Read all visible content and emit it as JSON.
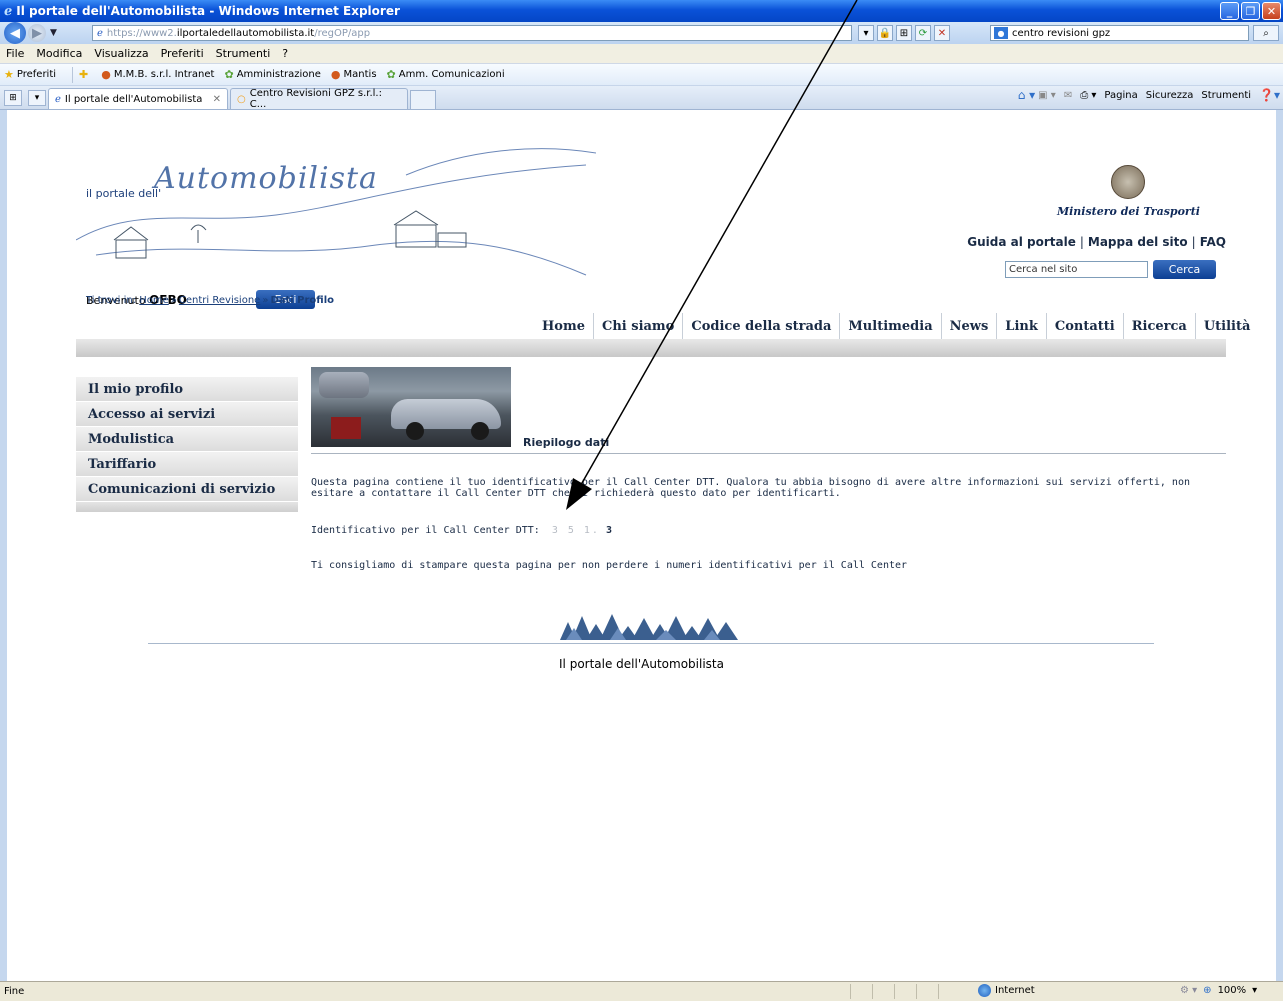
{
  "window": {
    "title": "Il portale dell'Automobilista - Windows Internet Explorer"
  },
  "address_bar": {
    "url_prefix": "https://www2.",
    "url_host": "ilportaledellautomobilista.it",
    "url_path": "/regOP/app",
    "search_value": "centro revisioni gpz"
  },
  "menu": [
    "File",
    "Modifica",
    "Visualizza",
    "Preferiti",
    "Strumenti",
    "?"
  ],
  "favorites": {
    "label": "Preferiti",
    "items": [
      "M.M.B. s.r.l. Intranet",
      "Amministrazione",
      "Mantis",
      "Amm. Comunicazioni"
    ]
  },
  "tabs": [
    {
      "label": "Il portale dell'Automobilista",
      "active": true
    },
    {
      "label": "Centro Revisioni GPZ s.r.l.: C...",
      "active": false
    }
  ],
  "command_bar": [
    "Pagina",
    "Sicurezza",
    "Strumenti"
  ],
  "page": {
    "logo_small": "il portale dell'",
    "logo_big": "Automobilista",
    "welcome_prefix": "Benvenuto",
    "user": "OFBO",
    "logout": "Esci",
    "ministry": "Ministero dei Trasporti",
    "toplinks": [
      "Guida al portale",
      "Mappa del sito",
      "FAQ"
    ],
    "search_placeholder": "Cerca nel sito",
    "search_button": "Cerca",
    "breadcrumb": {
      "prefix": "Ti trovi in:",
      "home": "Home",
      "section": "Centri Revisione",
      "current": "Dati Profilo"
    },
    "nav": [
      "Home",
      "Chi siamo",
      "Codice della strada",
      "Multimedia",
      "News",
      "Link",
      "Contatti",
      "Ricerca",
      "Utilità"
    ],
    "sidebar": [
      "Il mio profilo",
      "Accesso ai servizi",
      "Modulistica",
      "Tariffario",
      "Comunicazioni di servizio"
    ],
    "section_title": "Riepilogo dati",
    "paragraph1": "Questa pagina contiene il tuo identificativo per il Call Center DTT. Qualora tu abbia bisogno di avere altre informazioni sui servizi offerti, non esitare a contattare il Call Center DTT che ti richiederà questo dato per identificarti.",
    "ident_label": "Identificativo per il Call Center DTT:",
    "ident_value_blurred": "3  5  1.",
    "ident_value_last": "3",
    "paragraph2": "Ti consigliamo di stampare questa pagina per non perdere i numeri identificativi per il Call Center",
    "footer": "Il portale dell'Automobilista"
  },
  "status": {
    "text": "Fine",
    "zone": "Internet",
    "zoom": "100%"
  }
}
